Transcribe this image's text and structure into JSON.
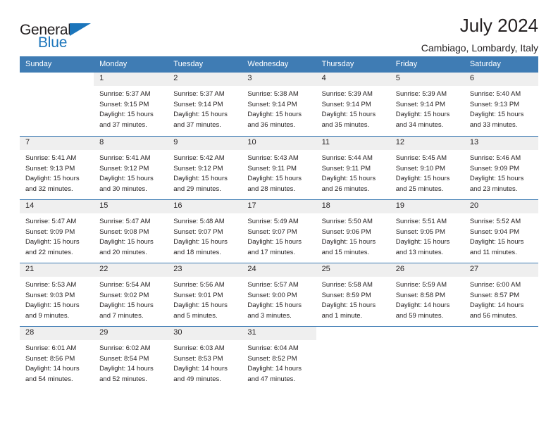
{
  "brand": {
    "name_part1": "General",
    "name_part2": "Blue",
    "triangle_icon": "triangle-icon",
    "accent_color": "#1b75bb"
  },
  "header": {
    "title": "July 2024",
    "subtitle": "Cambiago, Lombardy, Italy"
  },
  "calendar": {
    "header_bg": "#3f7cb4",
    "day_band_bg": "#efefef",
    "weekdays": [
      "Sunday",
      "Monday",
      "Tuesday",
      "Wednesday",
      "Thursday",
      "Friday",
      "Saturday"
    ],
    "weeks": [
      [
        {
          "day": "",
          "blank": true
        },
        {
          "day": "1",
          "sunrise": "Sunrise: 5:37 AM",
          "sunset": "Sunset: 9:15 PM",
          "daylight_line1": "Daylight: 15 hours",
          "daylight_line2": "and 37 minutes."
        },
        {
          "day": "2",
          "sunrise": "Sunrise: 5:37 AM",
          "sunset": "Sunset: 9:14 PM",
          "daylight_line1": "Daylight: 15 hours",
          "daylight_line2": "and 37 minutes."
        },
        {
          "day": "3",
          "sunrise": "Sunrise: 5:38 AM",
          "sunset": "Sunset: 9:14 PM",
          "daylight_line1": "Daylight: 15 hours",
          "daylight_line2": "and 36 minutes."
        },
        {
          "day": "4",
          "sunrise": "Sunrise: 5:39 AM",
          "sunset": "Sunset: 9:14 PM",
          "daylight_line1": "Daylight: 15 hours",
          "daylight_line2": "and 35 minutes."
        },
        {
          "day": "5",
          "sunrise": "Sunrise: 5:39 AM",
          "sunset": "Sunset: 9:14 PM",
          "daylight_line1": "Daylight: 15 hours",
          "daylight_line2": "and 34 minutes."
        },
        {
          "day": "6",
          "sunrise": "Sunrise: 5:40 AM",
          "sunset": "Sunset: 9:13 PM",
          "daylight_line1": "Daylight: 15 hours",
          "daylight_line2": "and 33 minutes."
        }
      ],
      [
        {
          "day": "7",
          "sunrise": "Sunrise: 5:41 AM",
          "sunset": "Sunset: 9:13 PM",
          "daylight_line1": "Daylight: 15 hours",
          "daylight_line2": "and 32 minutes."
        },
        {
          "day": "8",
          "sunrise": "Sunrise: 5:41 AM",
          "sunset": "Sunset: 9:12 PM",
          "daylight_line1": "Daylight: 15 hours",
          "daylight_line2": "and 30 minutes."
        },
        {
          "day": "9",
          "sunrise": "Sunrise: 5:42 AM",
          "sunset": "Sunset: 9:12 PM",
          "daylight_line1": "Daylight: 15 hours",
          "daylight_line2": "and 29 minutes."
        },
        {
          "day": "10",
          "sunrise": "Sunrise: 5:43 AM",
          "sunset": "Sunset: 9:11 PM",
          "daylight_line1": "Daylight: 15 hours",
          "daylight_line2": "and 28 minutes."
        },
        {
          "day": "11",
          "sunrise": "Sunrise: 5:44 AM",
          "sunset": "Sunset: 9:11 PM",
          "daylight_line1": "Daylight: 15 hours",
          "daylight_line2": "and 26 minutes."
        },
        {
          "day": "12",
          "sunrise": "Sunrise: 5:45 AM",
          "sunset": "Sunset: 9:10 PM",
          "daylight_line1": "Daylight: 15 hours",
          "daylight_line2": "and 25 minutes."
        },
        {
          "day": "13",
          "sunrise": "Sunrise: 5:46 AM",
          "sunset": "Sunset: 9:09 PM",
          "daylight_line1": "Daylight: 15 hours",
          "daylight_line2": "and 23 minutes."
        }
      ],
      [
        {
          "day": "14",
          "sunrise": "Sunrise: 5:47 AM",
          "sunset": "Sunset: 9:09 PM",
          "daylight_line1": "Daylight: 15 hours",
          "daylight_line2": "and 22 minutes."
        },
        {
          "day": "15",
          "sunrise": "Sunrise: 5:47 AM",
          "sunset": "Sunset: 9:08 PM",
          "daylight_line1": "Daylight: 15 hours",
          "daylight_line2": "and 20 minutes."
        },
        {
          "day": "16",
          "sunrise": "Sunrise: 5:48 AM",
          "sunset": "Sunset: 9:07 PM",
          "daylight_line1": "Daylight: 15 hours",
          "daylight_line2": "and 18 minutes."
        },
        {
          "day": "17",
          "sunrise": "Sunrise: 5:49 AM",
          "sunset": "Sunset: 9:07 PM",
          "daylight_line1": "Daylight: 15 hours",
          "daylight_line2": "and 17 minutes."
        },
        {
          "day": "18",
          "sunrise": "Sunrise: 5:50 AM",
          "sunset": "Sunset: 9:06 PM",
          "daylight_line1": "Daylight: 15 hours",
          "daylight_line2": "and 15 minutes."
        },
        {
          "day": "19",
          "sunrise": "Sunrise: 5:51 AM",
          "sunset": "Sunset: 9:05 PM",
          "daylight_line1": "Daylight: 15 hours",
          "daylight_line2": "and 13 minutes."
        },
        {
          "day": "20",
          "sunrise": "Sunrise: 5:52 AM",
          "sunset": "Sunset: 9:04 PM",
          "daylight_line1": "Daylight: 15 hours",
          "daylight_line2": "and 11 minutes."
        }
      ],
      [
        {
          "day": "21",
          "sunrise": "Sunrise: 5:53 AM",
          "sunset": "Sunset: 9:03 PM",
          "daylight_line1": "Daylight: 15 hours",
          "daylight_line2": "and 9 minutes."
        },
        {
          "day": "22",
          "sunrise": "Sunrise: 5:54 AM",
          "sunset": "Sunset: 9:02 PM",
          "daylight_line1": "Daylight: 15 hours",
          "daylight_line2": "and 7 minutes."
        },
        {
          "day": "23",
          "sunrise": "Sunrise: 5:56 AM",
          "sunset": "Sunset: 9:01 PM",
          "daylight_line1": "Daylight: 15 hours",
          "daylight_line2": "and 5 minutes."
        },
        {
          "day": "24",
          "sunrise": "Sunrise: 5:57 AM",
          "sunset": "Sunset: 9:00 PM",
          "daylight_line1": "Daylight: 15 hours",
          "daylight_line2": "and 3 minutes."
        },
        {
          "day": "25",
          "sunrise": "Sunrise: 5:58 AM",
          "sunset": "Sunset: 8:59 PM",
          "daylight_line1": "Daylight: 15 hours",
          "daylight_line2": "and 1 minute."
        },
        {
          "day": "26",
          "sunrise": "Sunrise: 5:59 AM",
          "sunset": "Sunset: 8:58 PM",
          "daylight_line1": "Daylight: 14 hours",
          "daylight_line2": "and 59 minutes."
        },
        {
          "day": "27",
          "sunrise": "Sunrise: 6:00 AM",
          "sunset": "Sunset: 8:57 PM",
          "daylight_line1": "Daylight: 14 hours",
          "daylight_line2": "and 56 minutes."
        }
      ],
      [
        {
          "day": "28",
          "sunrise": "Sunrise: 6:01 AM",
          "sunset": "Sunset: 8:56 PM",
          "daylight_line1": "Daylight: 14 hours",
          "daylight_line2": "and 54 minutes."
        },
        {
          "day": "29",
          "sunrise": "Sunrise: 6:02 AM",
          "sunset": "Sunset: 8:54 PM",
          "daylight_line1": "Daylight: 14 hours",
          "daylight_line2": "and 52 minutes."
        },
        {
          "day": "30",
          "sunrise": "Sunrise: 6:03 AM",
          "sunset": "Sunset: 8:53 PM",
          "daylight_line1": "Daylight: 14 hours",
          "daylight_line2": "and 49 minutes."
        },
        {
          "day": "31",
          "sunrise": "Sunrise: 6:04 AM",
          "sunset": "Sunset: 8:52 PM",
          "daylight_line1": "Daylight: 14 hours",
          "daylight_line2": "and 47 minutes."
        },
        {
          "day": "",
          "blank": true
        },
        {
          "day": "",
          "blank": true
        },
        {
          "day": "",
          "blank": true
        }
      ]
    ]
  }
}
